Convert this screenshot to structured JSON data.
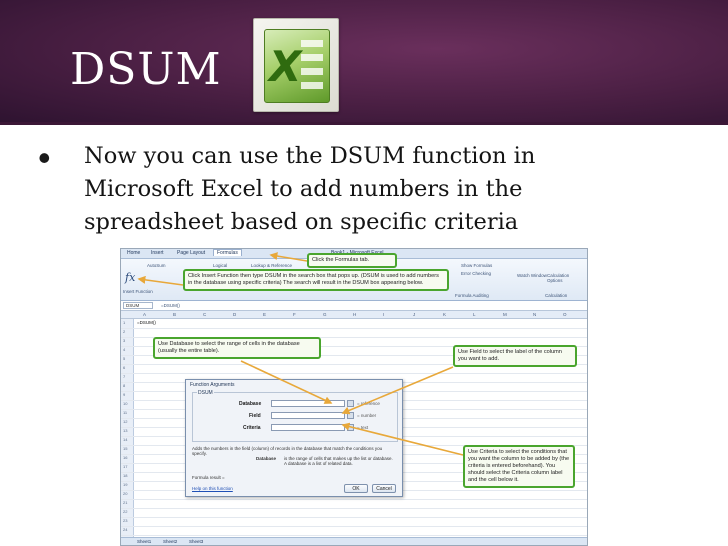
{
  "slide": {
    "title": "DSUM",
    "bullet": "Now you can use the DSUM function in Microsoft Excel to add numbers in the spreadsheet based on specific criteria"
  },
  "colors": {
    "header_bg": "#4a1f43",
    "callout_border": "#4aa52e",
    "excel_green": "#5f9a2a"
  },
  "icons": {
    "logo": "excel-logo-icon",
    "bullet": "bullet-dot-icon",
    "fx": "insert-function-icon"
  },
  "screenshot": {
    "tabs": [
      "Home",
      "Insert",
      "Page Layout",
      "Formulas"
    ],
    "active_tab": "Formulas",
    "window_title": "Book1 - Microsoft Excel",
    "ribbon_items": {
      "autosum": "AutoSum",
      "insert_function": "Insert Function",
      "logical": "Logical",
      "lookup": "Lookup & Reference",
      "show_formulas": "Show Formulas",
      "error_checking": "Error Checking",
      "watch_window": "Watch Window",
      "calc_options": "Calculation Options",
      "formula_auditing": "Formula Auditing",
      "calculation": "Calculation"
    },
    "namebox": "DSUM",
    "formula": "=DSUM()",
    "columns": [
      "A",
      "B",
      "C",
      "D",
      "E",
      "F",
      "G",
      "H",
      "I",
      "J",
      "K",
      "L",
      "M",
      "N",
      "O"
    ],
    "rows": [
      "1",
      "2",
      "3",
      "4",
      "5",
      "6",
      "7",
      "8",
      "9",
      "10",
      "11",
      "12",
      "13",
      "14",
      "15",
      "16",
      "17",
      "18",
      "19",
      "20",
      "21",
      "22",
      "23",
      "24"
    ],
    "cell_a1": "=DSUM()",
    "sheet_tabs": [
      "Sheet1",
      "Sheet2",
      "Sheet3"
    ],
    "callouts": {
      "formulas_tab": "Click the Formulas tab.",
      "insert_function": "Click Insert Function then type DSUM in the search box that pops up. (DSUM is used to add numbers in the database using specific criteria) The search will result in the DSUM box appearing below.",
      "database": "Use Database to select the range of cells in the database (usually the entire table).",
      "field": "Use Field to select the label of the column you want to add.",
      "criteria": "Use Criteria to select the conditions that you want the column to be added by (the criteria is entered beforehand). You should select the Criteria column label and the cell below it."
    },
    "dialog": {
      "title": "Function Arguments",
      "function_name": "DSUM",
      "args": [
        {
          "label": "Database",
          "hint": "= reference"
        },
        {
          "label": "Field",
          "hint": "= number"
        },
        {
          "label": "Criteria",
          "hint": "= text"
        }
      ],
      "description": "Adds the numbers in the field (column) of records in the database that match the conditions you specify.",
      "detail_label": "Database",
      "detail_text": "is the range of cells that makes up the list or database. A database is a list of related data.",
      "formula_result": "Formula result =",
      "help_link": "Help on this function",
      "ok": "OK",
      "cancel": "Cancel"
    }
  }
}
